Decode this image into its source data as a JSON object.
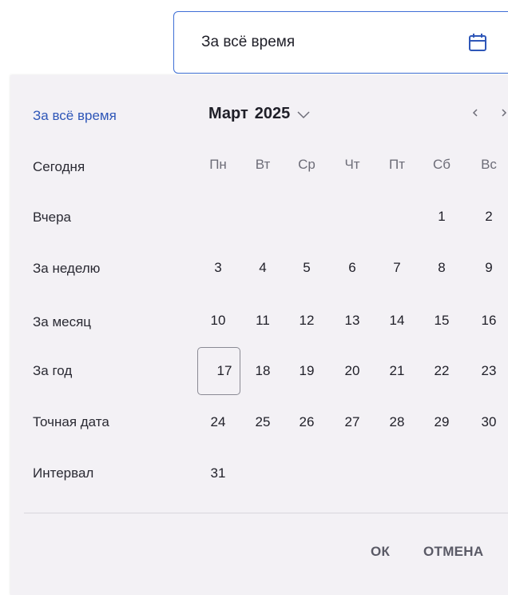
{
  "field": {
    "value": "За всё время",
    "icon": "calendar-icon"
  },
  "presets": [
    {
      "label": "За всё время",
      "active": true
    },
    {
      "label": "Сегодня"
    },
    {
      "label": "Вчера"
    },
    {
      "label": "За неделю"
    },
    {
      "label": "За месяц"
    },
    {
      "label": "За год"
    },
    {
      "label": "Точная дата"
    },
    {
      "label": "Интервал"
    }
  ],
  "calendar": {
    "month": "Март",
    "year": "2025",
    "weekdays": [
      "Пн",
      "Вт",
      "Ср",
      "Чт",
      "Пт",
      "Сб",
      "Вс"
    ],
    "weeks": [
      [
        "",
        "",
        "",
        "",
        "",
        "1",
        "2"
      ],
      [
        "3",
        "4",
        "5",
        "6",
        "7",
        "8",
        "9"
      ],
      [
        "10",
        "11",
        "12",
        "13",
        "14",
        "15",
        "16"
      ],
      [
        "17",
        "18",
        "19",
        "20",
        "21",
        "22",
        "23"
      ],
      [
        "24",
        "25",
        "26",
        "27",
        "28",
        "29",
        "30"
      ],
      [
        "31",
        "",
        "",
        "",
        "",
        "",
        ""
      ]
    ],
    "selected": "17"
  },
  "actions": {
    "ok": "ОК",
    "cancel": "ОТМЕНА"
  },
  "colors": {
    "accent": "#2f57b8",
    "panel_bg": "#f3f1f5",
    "field_border": "#3f6fd6"
  }
}
